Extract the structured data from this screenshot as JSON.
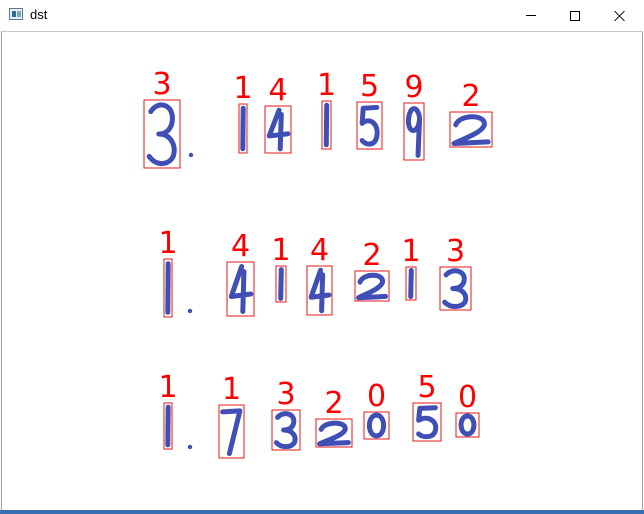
{
  "window": {
    "title": "dst",
    "controls": [
      "minimize",
      "maximize",
      "close"
    ]
  },
  "rows": [
    {
      "digits": [
        {
          "label": "3",
          "glyph": "3"
        },
        {
          "label": "1",
          "glyph": "1"
        },
        {
          "label": "4",
          "glyph": "4"
        },
        {
          "label": "1",
          "glyph": "1"
        },
        {
          "label": "5",
          "glyph": "5"
        },
        {
          "label": "9",
          "glyph": "9"
        },
        {
          "label": "2",
          "glyph": "2"
        }
      ]
    },
    {
      "digits": [
        {
          "label": "1",
          "glyph": "1"
        },
        {
          "label": "4",
          "glyph": "4"
        },
        {
          "label": "1",
          "glyph": "1"
        },
        {
          "label": "4",
          "glyph": "4"
        },
        {
          "label": "2",
          "glyph": "2"
        },
        {
          "label": "1",
          "glyph": "1"
        },
        {
          "label": "3",
          "glyph": "3"
        }
      ]
    },
    {
      "digits": [
        {
          "label": "1",
          "glyph": "1"
        },
        {
          "label": "1",
          "glyph": "7"
        },
        {
          "label": "3",
          "glyph": "3"
        },
        {
          "label": "2",
          "glyph": "2"
        },
        {
          "label": "0",
          "glyph": "0"
        },
        {
          "label": "5",
          "glyph": "5"
        },
        {
          "label": "0",
          "glyph": "0"
        }
      ]
    }
  ],
  "colors": {
    "ink": "#3f4fb5",
    "box": "#e41a1a",
    "label": "#ff0000"
  }
}
